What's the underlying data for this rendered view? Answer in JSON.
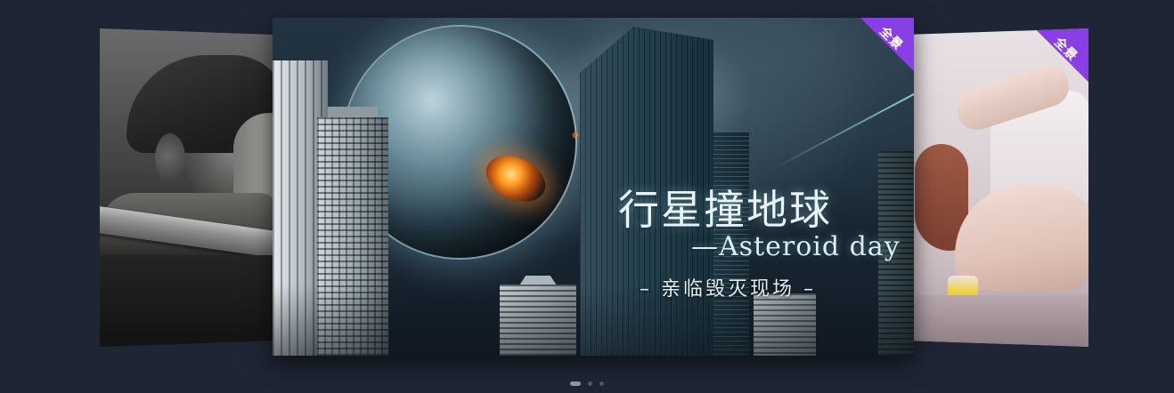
{
  "carousel": {
    "slides": [
      {
        "position": "left",
        "subject": "man-with-sword-portrait"
      },
      {
        "position": "center",
        "subject": "asteroid-city-poster",
        "badge": "全景",
        "title_cn": "行星撞地球",
        "title_en": "—Asteroid day",
        "subtitle": "– 亲临毁灭现场 –"
      },
      {
        "position": "right",
        "subject": "woman-lounging-photo",
        "badge": "全景"
      }
    ],
    "pagination": {
      "count": 3,
      "active_index": 0
    }
  },
  "colors": {
    "background": "#1e2534",
    "badge": "#8a3fe6",
    "dot_active": "#8a94a6",
    "dot_inactive": "#4a5568"
  }
}
